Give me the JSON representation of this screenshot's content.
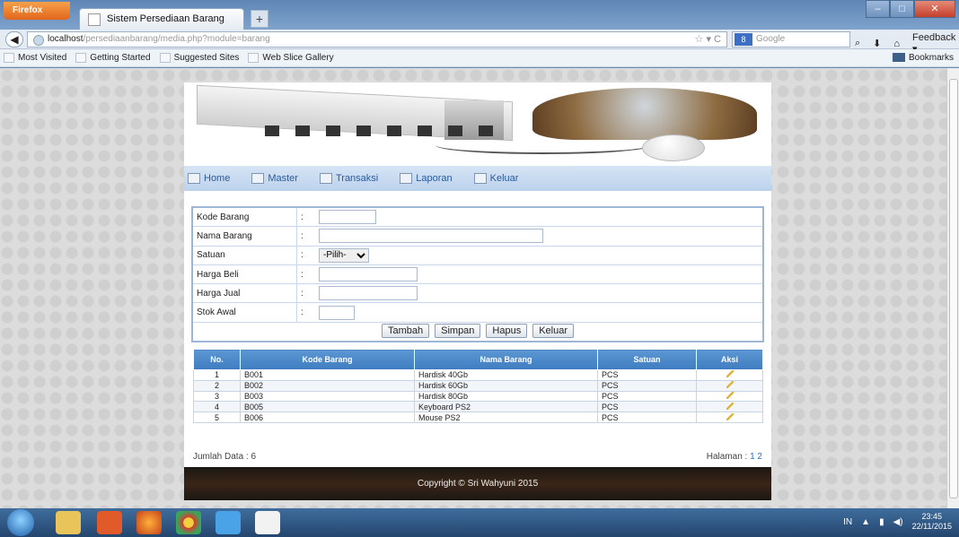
{
  "browser": {
    "app_button": "Firefox",
    "tab_title": "Sistem Persediaan Barang",
    "new_tab": "+",
    "url_host": "localhost",
    "url_path": "/persediaanbarang/media.php?module=barang",
    "search_placeholder": "Google",
    "feedback": "Feedback",
    "bookmarks_label": "Bookmarks",
    "bookmarks": [
      "Most Visited",
      "Getting Started",
      "Suggested Sites",
      "Web Slice Gallery"
    ]
  },
  "menu": [
    "Home",
    "Master",
    "Transaksi",
    "Laporan",
    "Keluar"
  ],
  "form": {
    "fields": [
      {
        "label": "Kode Barang",
        "value": ""
      },
      {
        "label": "Nama Barang",
        "value": ""
      },
      {
        "label": "Satuan",
        "value": "-Pilih-"
      },
      {
        "label": "Harga Beli",
        "value": ""
      },
      {
        "label": "Harga Jual",
        "value": ""
      },
      {
        "label": "Stok Awal",
        "value": ""
      }
    ],
    "buttons": [
      "Tambah",
      "Simpan",
      "Hapus",
      "Keluar"
    ]
  },
  "table": {
    "headers": [
      "No.",
      "Kode Barang",
      "Nama Barang",
      "Satuan",
      "Aksi"
    ],
    "rows": [
      {
        "no": "1",
        "kode": "B001",
        "nama": "Hardisk 40Gb",
        "satuan": "PCS"
      },
      {
        "no": "2",
        "kode": "B002",
        "nama": "Hardisk 60Gb",
        "satuan": "PCS"
      },
      {
        "no": "3",
        "kode": "B003",
        "nama": "Hardisk 80Gb",
        "satuan": "PCS"
      },
      {
        "no": "4",
        "kode": "B005",
        "nama": "Keyboard PS2",
        "satuan": "PCS"
      },
      {
        "no": "5",
        "kode": "B006",
        "nama": "Mouse PS2",
        "satuan": "PCS"
      }
    ]
  },
  "footer_info": {
    "jumlah": "Jumlah Data : 6",
    "halaman_label": "Halaman :",
    "pages": "1 2"
  },
  "copyright": "Copyright © Sri Wahyuni 2015",
  "taskbar": {
    "lang": "IN",
    "time": "23:45",
    "date": "22/11/2015"
  }
}
